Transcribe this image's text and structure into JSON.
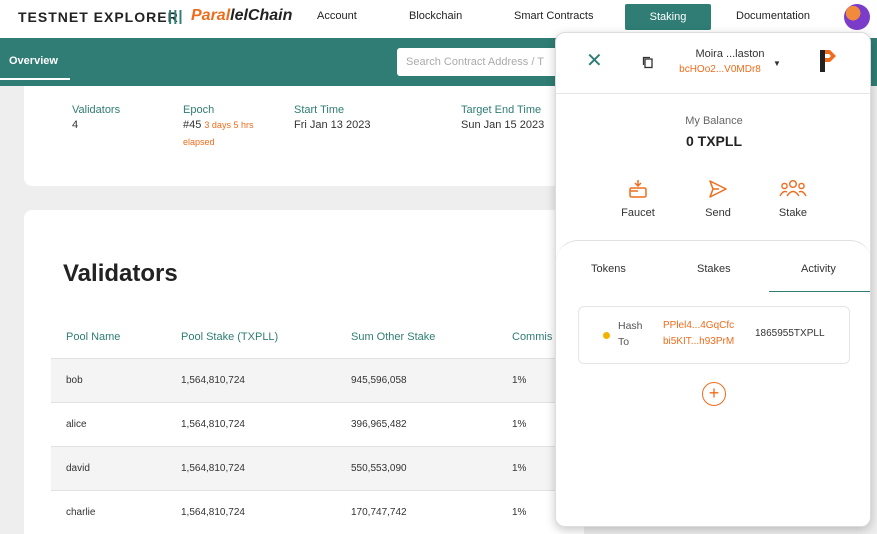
{
  "header": {
    "brand": "TESTNET EXPLORER",
    "separator": "|||",
    "logo_part1": "Paral",
    "logo_part2": "lelChain",
    "nav": [
      "Account",
      "Blockchain",
      "Smart Contracts",
      "Staking",
      "Documentation"
    ],
    "active_nav": "Staking"
  },
  "subnav": {
    "tab": "Overview",
    "search_placeholder": "Search Contract Address / T"
  },
  "epoch_card": {
    "validators_label": "Validators",
    "validators_value": "4",
    "epoch_label": "Epoch",
    "epoch_value": "#45",
    "epoch_duration": "3 days 5 hrs",
    "epoch_elapsed": "elapsed",
    "start_label": "Start Time",
    "start_value": "Fri Jan 13 2023",
    "target_label": "Target End Time",
    "target_value": "Sun Jan 15 2023"
  },
  "validators": {
    "title": "Validators",
    "columns": [
      "Pool Name",
      "Pool Stake (TXPLL)",
      "Sum Other Stake",
      "Commis"
    ],
    "rows": [
      {
        "name": "bob",
        "pool_stake": "1,564,810,724",
        "other_stake": "945,596,058",
        "commission": "1%"
      },
      {
        "name": "alice",
        "pool_stake": "1,564,810,724",
        "other_stake": "396,965,482",
        "commission": "1%"
      },
      {
        "name": "david",
        "pool_stake": "1,564,810,724",
        "other_stake": "550,553,090",
        "commission": "1%"
      },
      {
        "name": "charlie",
        "pool_stake": "1,564,810,724",
        "other_stake": "170,747,742",
        "commission": "1%"
      }
    ]
  },
  "wallet": {
    "account_name": "Moira ...laston",
    "account_address": "bcHOo2...V0MDr8",
    "balance_label": "My Balance",
    "balance": "0 TXPLL",
    "actions": [
      "Faucet",
      "Send",
      "Stake"
    ],
    "tabs": [
      "Tokens",
      "Stakes",
      "Activity"
    ],
    "active_tab": "Activity",
    "activity": {
      "hash_label": "Hash",
      "to_label": "To",
      "hash": "PPlel4...4GqCfc",
      "to": "bi5KIT...h93PrM",
      "amount": "1865955TXPLL",
      "status_color": "#f2b400"
    },
    "add_label": "+"
  },
  "colors": {
    "primary": "#2f7d74",
    "accent": "#ef6c1c"
  }
}
